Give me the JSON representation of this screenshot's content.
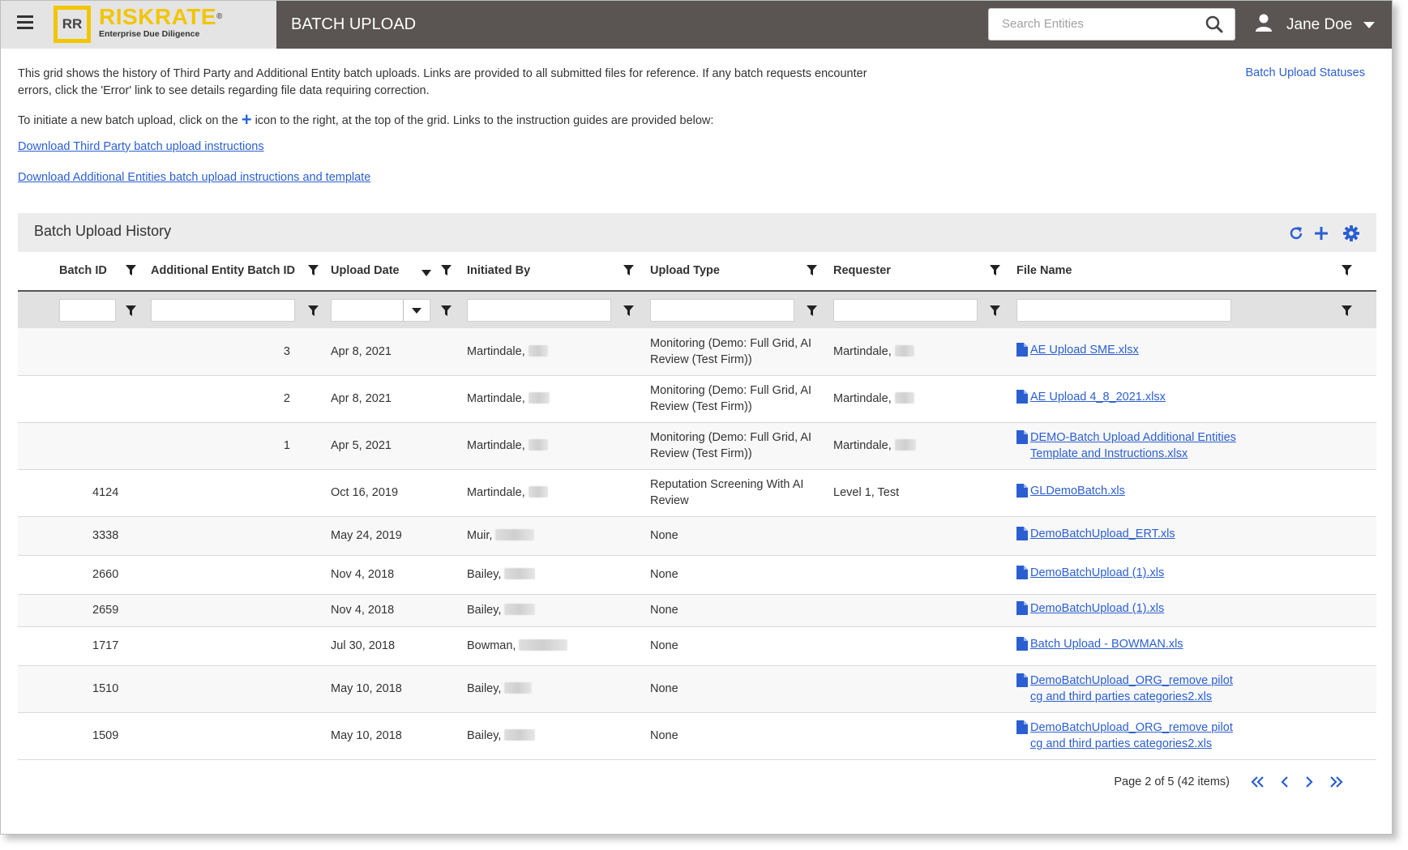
{
  "app": {
    "logo_initials": "RR",
    "logo_name": "RISKRATE",
    "logo_reg": "®",
    "logo_tagline": "Enterprise Due Diligence",
    "page_title": "BATCH UPLOAD"
  },
  "search": {
    "placeholder": "Search Entities",
    "value": ""
  },
  "user": {
    "name": "Jane Doe"
  },
  "intro": {
    "paragraph1": "This grid shows the history of Third Party and Additional Entity batch uploads. Links are provided to all submitted files for reference. If any batch requests encounter errors, click the 'Error' link to see details regarding file data requiring correction.",
    "paragraph2_before": "To initiate a new batch upload, click on the",
    "paragraph2_after": "icon to the right, at the top of the grid. Links to the instruction guides are provided below:",
    "link_third_party": "Download Third Party batch upload instructions",
    "link_additional": "Download Additional Entities batch upload instructions and template",
    "statuses_link": "Batch Upload Statuses"
  },
  "grid": {
    "title": "Batch Upload History",
    "columns": [
      "Batch ID",
      "Additional Entity Batch ID",
      "Upload Date",
      "Initiated By",
      "Upload Type",
      "Requester",
      "File Name"
    ],
    "rows": [
      {
        "batch_id": "",
        "ae_batch_id": "3",
        "upload_date": "Apr 8, 2021",
        "initiated_by": "Martindale,",
        "upload_type": "Monitoring (Demo: Full Grid, AI Review (Test Firm))",
        "requester": "Martindale,",
        "file_name": "AE Upload SME.xlsx"
      },
      {
        "batch_id": "",
        "ae_batch_id": "2",
        "upload_date": "Apr 8, 2021",
        "initiated_by": "Martindale,",
        "upload_type": "Monitoring (Demo: Full Grid, AI Review (Test Firm))",
        "requester": "Martindale,",
        "file_name": "AE Upload 4_8_2021.xlsx"
      },
      {
        "batch_id": "",
        "ae_batch_id": "1",
        "upload_date": "Apr 5, 2021",
        "initiated_by": "Martindale,",
        "upload_type": "Monitoring (Demo: Full Grid, AI Review (Test Firm))",
        "requester": "Martindale,",
        "file_name": "DEMO-Batch Upload Additional Entities Template and Instructions.xlsx"
      },
      {
        "batch_id": "4124",
        "ae_batch_id": "",
        "upload_date": "Oct 16, 2019",
        "initiated_by": "Martindale,",
        "upload_type": "Reputation Screening With AI Review",
        "requester": "Level 1, Test",
        "file_name": "GLDemoBatch.xls"
      },
      {
        "batch_id": "3338",
        "ae_batch_id": "",
        "upload_date": "May 24, 2019",
        "initiated_by": "Muir,",
        "upload_type": "None",
        "requester": "",
        "file_name": "DemoBatchUpload_ERT.xls"
      },
      {
        "batch_id": "2660",
        "ae_batch_id": "",
        "upload_date": "Nov 4, 2018",
        "initiated_by": "Bailey,",
        "upload_type": "None",
        "requester": "",
        "file_name": "DemoBatchUpload (1).xls"
      },
      {
        "batch_id": "2659",
        "ae_batch_id": "",
        "upload_date": "Nov 4, 2018",
        "initiated_by": "Bailey,",
        "upload_type": "None",
        "requester": "",
        "file_name": "DemoBatchUpload (1).xls"
      },
      {
        "batch_id": "1717",
        "ae_batch_id": "",
        "upload_date": "Jul 30, 2018",
        "initiated_by": "Bowman,",
        "upload_type": "None",
        "requester": "",
        "file_name": "Batch Upload - BOWMAN.xls"
      },
      {
        "batch_id": "1510",
        "ae_batch_id": "",
        "upload_date": "May 10, 2018",
        "initiated_by": "Bailey,",
        "upload_type": "None",
        "requester": "",
        "file_name": "DemoBatchUpload_ORG_remove pilot cg and third parties categories2.xls"
      },
      {
        "batch_id": "1509",
        "ae_batch_id": "",
        "upload_date": "May 10, 2018",
        "initiated_by": "Bailey,",
        "upload_type": "None",
        "requester": "",
        "file_name": "DemoBatchUpload_ORG_remove pilot cg and third parties categories2.xls"
      }
    ]
  },
  "pager": {
    "info": "Page 2 of 5 (42 items)"
  },
  "colors": {
    "topbar": "#5a5553",
    "brand_bg": "#e4e4e4",
    "logo_yellow": "#f2c500",
    "link_blue": "#2b5fd1"
  },
  "icons": [
    "menu-icon",
    "search-icon",
    "user-icon",
    "chevron-down-icon",
    "plus-icon",
    "refresh-icon",
    "gear-icon",
    "filter-icon",
    "file-icon",
    "first-page-icon",
    "prev-page-icon",
    "next-page-icon",
    "last-page-icon"
  ]
}
